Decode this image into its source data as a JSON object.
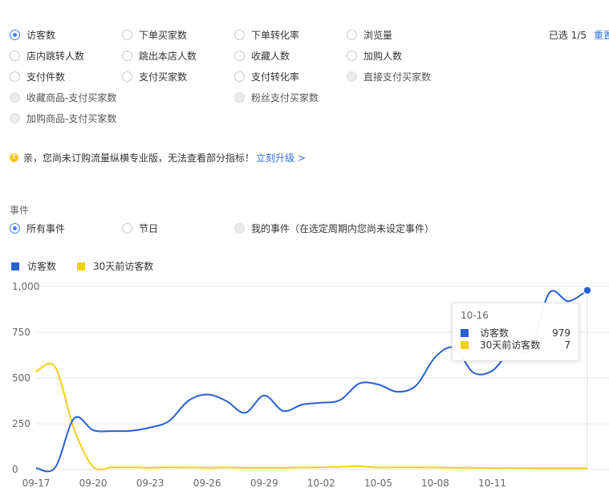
{
  "metrics": [
    {
      "label": "访客数",
      "state": "checked"
    },
    {
      "label": "下单买家数",
      "state": "normal"
    },
    {
      "label": "下单转化率",
      "state": "normal"
    },
    {
      "label": "浏览量",
      "state": "normal"
    },
    {
      "label": "店内跳转人数",
      "state": "normal"
    },
    {
      "label": "跳出本店人数",
      "state": "normal"
    },
    {
      "label": "收藏人数",
      "state": "normal"
    },
    {
      "label": "加购人数",
      "state": "normal"
    },
    {
      "label": "支付件数",
      "state": "normal"
    },
    {
      "label": "支付买家数",
      "state": "normal"
    },
    {
      "label": "支付转化率",
      "state": "normal"
    },
    {
      "label": "直接支付买家数",
      "state": "disabled"
    },
    {
      "label": "收藏商品-支付买家数",
      "state": "disabled"
    },
    {
      "label": "粉丝支付买家数",
      "state": "disabled"
    },
    {
      "label": "加购商品-支付买家数",
      "state": "disabled"
    }
  ],
  "selection": {
    "count_text": "已选 1/5",
    "reset_label": "重置"
  },
  "notice": {
    "text": "亲，您尚未订购流量纵横专业版，无法查看部分指标！",
    "link": "立刻升级 >"
  },
  "events": {
    "title": "事件",
    "options": [
      {
        "label": "所有事件",
        "state": "checked"
      },
      {
        "label": "节日",
        "state": "normal"
      },
      {
        "label": "我的事件（在选定周期内您尚未设定事件）",
        "state": "disabled"
      }
    ]
  },
  "colors": {
    "blue": "#2660d1",
    "yellow": "#f2cf1c",
    "accent": "#2f6fd6"
  },
  "chart_data": {
    "type": "line",
    "x": [
      "09-17",
      "09-18",
      "09-19",
      "09-20",
      "09-21",
      "09-22",
      "09-23",
      "09-24",
      "09-25",
      "09-26",
      "09-27",
      "09-28",
      "09-29",
      "09-30",
      "10-01",
      "10-02",
      "10-03",
      "10-04",
      "10-05",
      "10-06",
      "10-07",
      "10-08",
      "10-09",
      "10-10",
      "10-11",
      "10-12",
      "10-13",
      "10-14",
      "10-15",
      "10-16"
    ],
    "x_tick_labels": [
      "09-17",
      "09-20",
      "09-23",
      "09-26",
      "09-29",
      "10-02",
      "10-05",
      "10-08",
      "10-11"
    ],
    "series": [
      {
        "name": "访客数",
        "color": "#2660d1",
        "values": [
          8,
          10,
          280,
          215,
          210,
          212,
          230,
          265,
          375,
          410,
          375,
          310,
          405,
          320,
          355,
          365,
          380,
          470,
          465,
          425,
          460,
          615,
          665,
          530,
          540,
          650,
          655,
          965,
          920,
          979
        ]
      },
      {
        "name": "30天前访客数",
        "color": "#f2cf1c",
        "values": [
          535,
          560,
          220,
          15,
          12,
          12,
          10,
          12,
          11,
          10,
          11,
          10,
          10,
          10,
          11,
          12,
          15,
          18,
          11,
          12,
          12,
          11,
          10,
          10,
          8,
          8,
          7,
          7,
          7,
          7
        ]
      }
    ],
    "y_ticks": [
      0,
      250,
      500,
      750,
      1000
    ],
    "y_tick_labels": [
      "0",
      "250",
      "500",
      "750",
      "1,000"
    ],
    "ylim": [
      0,
      1000
    ],
    "grid": true,
    "legend": "top-left",
    "tooltip": {
      "date": "10-16",
      "rows": [
        {
          "name": "访客数",
          "value": "979"
        },
        {
          "name": "30天前访客数",
          "value": "7"
        }
      ]
    }
  }
}
